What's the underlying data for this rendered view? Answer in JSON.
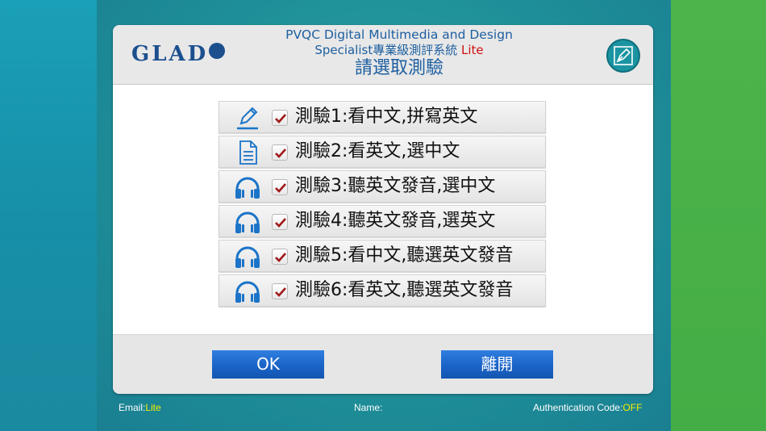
{
  "header": {
    "logo_text": "GLAD",
    "title_line1": "PVQC Digital Multimedia and Design",
    "title_line2_prefix": "Specialist專業級測評系統",
    "title_line2_suffix": "Lite",
    "subtitle": "請選取測驗",
    "pen_icon": "pen-icon"
  },
  "tests": [
    {
      "label": "測驗1:看中文,拼寫英文",
      "icon": "pencil-icon",
      "checked": true
    },
    {
      "label": "測驗2:看英文,選中文",
      "icon": "document-icon",
      "checked": true
    },
    {
      "label": "測驗3:聽英文發音,選中文",
      "icon": "headphones-icon",
      "checked": true
    },
    {
      "label": "測驗4:聽英文發音,選英文",
      "icon": "headphones-icon",
      "checked": true
    },
    {
      "label": "測驗5:看中文,聽選英文發音",
      "icon": "headphones-icon",
      "checked": true
    },
    {
      "label": "測驗6:看英文,聽選英文發音",
      "icon": "headphones-icon",
      "checked": true
    }
  ],
  "buttons": {
    "ok": "OK",
    "exit": "離開"
  },
  "status_bar": {
    "email_label": "Email:",
    "email_value": "Lite",
    "name_label": "Name:",
    "auth_label": "Authentication Code:",
    "auth_value": "OFF"
  },
  "colors": {
    "title_blue": "#1d5fa0",
    "icon_blue": "#1b74c8",
    "check_red": "#a01818",
    "button_blue": "#1a63c6",
    "status_yellow": "#f4f000"
  }
}
